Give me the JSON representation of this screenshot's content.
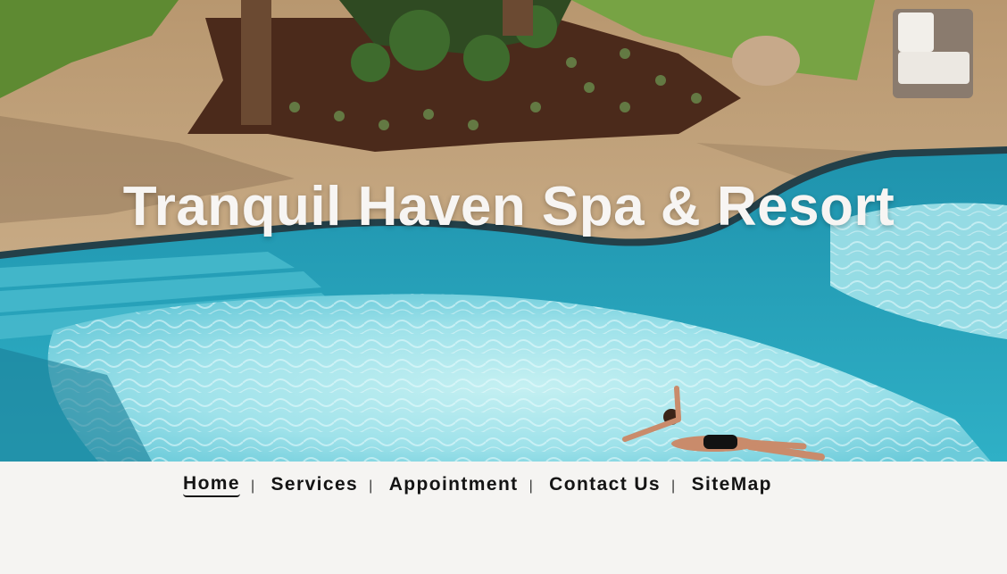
{
  "hero": {
    "title": "Tranquil Haven Spa & Resort",
    "image_description_icon": "pool-photo",
    "colors": {
      "water": "#2aa7bf",
      "shallow": "#8fdde6",
      "deck": "#cdb08f",
      "lawn": "#6f9b3c",
      "soil": "#4a2b1c"
    }
  },
  "nav": {
    "separator": "|",
    "items": [
      {
        "label": "Home",
        "active": true
      },
      {
        "label": "Services",
        "active": false
      },
      {
        "label": "Appointment",
        "active": false
      },
      {
        "label": "Contact Us",
        "active": false
      },
      {
        "label": "SiteMap",
        "active": false
      }
    ]
  }
}
